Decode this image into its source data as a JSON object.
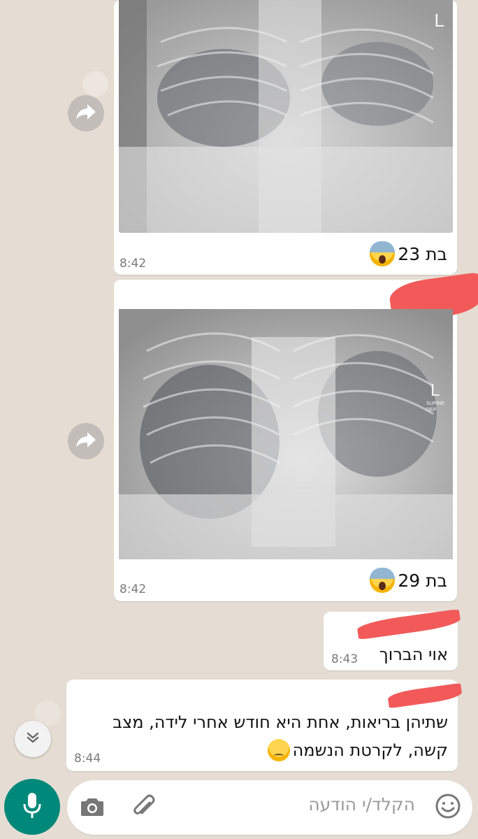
{
  "messages": [
    {
      "type": "image",
      "caption_text": "בת 23",
      "time": "8:42",
      "emoji": "face-screaming-in-fear"
    },
    {
      "type": "image",
      "caption_text": "בת 29",
      "time": "8:42",
      "emoji": "face-screaming-in-fear",
      "image_mark": "L",
      "image_mark_sub1": "SUPINE",
      "image_mark_sub2": "DEP"
    },
    {
      "type": "text",
      "text": "אוי הברוך",
      "time": "8:43"
    },
    {
      "type": "text",
      "line1": "שתיהן בריאות, אחת היא חודש אחרי לידה, מצב",
      "line2": "קשה, לקרטת הנשמה",
      "time": "8:44",
      "emoji": "pensive-face"
    }
  ],
  "first_image_mark": "L",
  "composer": {
    "placeholder": "הקלד/י הודעה",
    "icons": [
      "emoji-icon",
      "attach-icon",
      "camera-icon",
      "mic-icon"
    ]
  },
  "colors": {
    "accent": "#00897b",
    "bubble": "#ffffff",
    "redaction": "#f25a5a",
    "background": "#e5ddd3"
  }
}
